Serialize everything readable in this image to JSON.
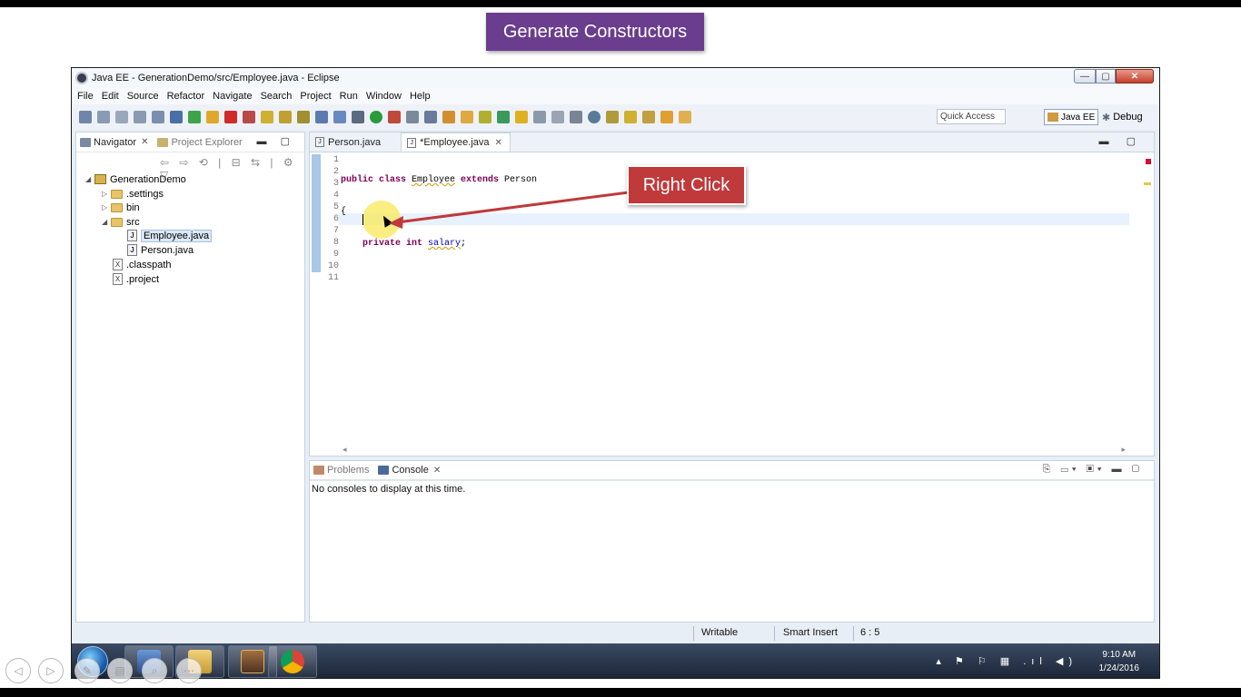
{
  "banner": {
    "text": "Generate Constructors"
  },
  "annotation": {
    "text": "Right Click"
  },
  "window": {
    "title": "Java EE - GenerationDemo/src/Employee.java - Eclipse",
    "controls": {
      "min": "—",
      "max": "▢",
      "close": "✕"
    }
  },
  "menu": [
    "File",
    "Edit",
    "Source",
    "Refactor",
    "Navigate",
    "Search",
    "Project",
    "Run",
    "Window",
    "Help"
  ],
  "toolbar": {
    "quick_access": "Quick Access",
    "perspectives": {
      "active": "Java EE",
      "other": "Debug"
    }
  },
  "navigator": {
    "tabs": {
      "active": "Navigator",
      "inactive": "Project Explorer"
    },
    "tree": {
      "project": "GenerationDemo",
      "settings": ".settings",
      "bin": "bin",
      "src": "src",
      "employee": "Employee.java",
      "person": "Person.java",
      "classpath": ".classpath",
      "project_file": ".project"
    }
  },
  "editor": {
    "tabs": {
      "first": "Person.java",
      "active": "*Employee.java"
    },
    "line_numbers": [
      "1",
      "2",
      "3",
      "4",
      "5",
      "6",
      "7",
      "8",
      "9",
      "10",
      "11"
    ],
    "code": {
      "l1_kw": "public class ",
      "l1_name": "Employee",
      "l1_kw2": " extends ",
      "l1_parent": "Person",
      "l2": "{",
      "l3_kw": "    private int ",
      "l3_field": "salary",
      "l3_end": ";",
      "l10": "}"
    }
  },
  "console": {
    "tabs": {
      "inactive": "Problems",
      "active": "Console"
    },
    "message": "No consoles to display at this time."
  },
  "status": {
    "writable": "Writable",
    "insert_mode": "Smart Insert",
    "position": "6 : 5"
  },
  "taskbar": {
    "time": "9:10 AM",
    "date": "1/24/2016"
  },
  "icons": {
    "app": "eclipse-icon",
    "start": "windows-start-icon",
    "taskbar_items": [
      "eclipse-workspace-icon",
      "file-explorer-icon",
      "java-ee-icon",
      "chrome-icon"
    ]
  },
  "colors": {
    "banner": "#6a3d8e",
    "annotation": "#c0393b",
    "keyword": "#7f0055",
    "field": "#0000c0"
  }
}
